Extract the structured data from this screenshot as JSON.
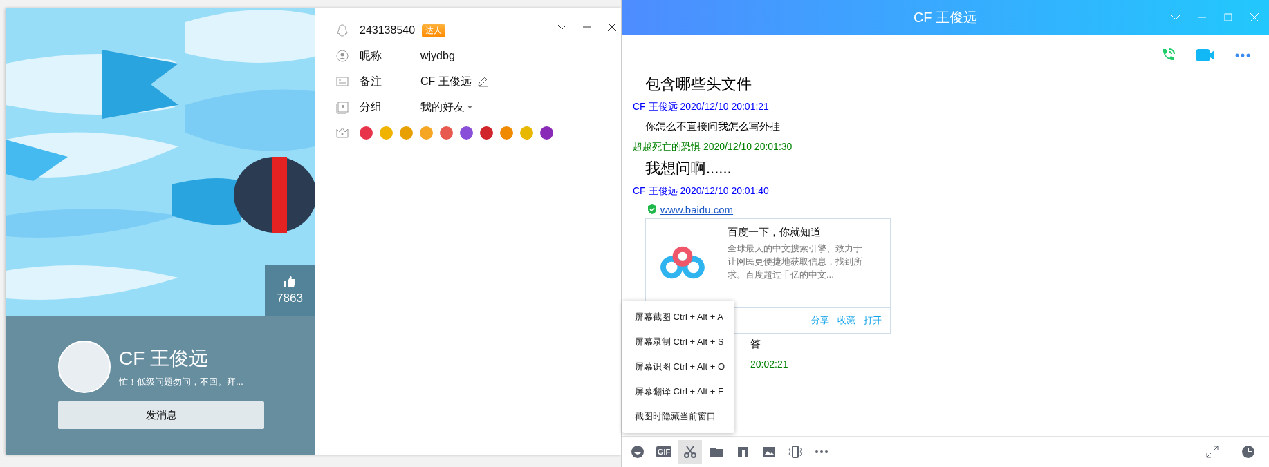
{
  "profile_window": {
    "qq_number": "243138540",
    "badge": "达人",
    "likes": "7863",
    "name": "CF 王俊远",
    "signature": "忙！低级问题勿问，不回。拜...",
    "send_button": "发消息",
    "fields": [
      {
        "kind": "nickname",
        "label": "昵称",
        "value": "wjydbg"
      },
      {
        "kind": "remark",
        "label": "备注",
        "value": "CF 王俊远"
      },
      {
        "kind": "group",
        "label": "分组",
        "value": "我的好友"
      }
    ],
    "medals": [
      {
        "color": "#e8344a"
      },
      {
        "color": "#f0b400"
      },
      {
        "color": "#e8a000"
      },
      {
        "color": "#f5a623"
      },
      {
        "color": "#e85a4f"
      },
      {
        "color": "#8a4fd8"
      },
      {
        "color": "#d0252a"
      },
      {
        "color": "#f08a00"
      },
      {
        "color": "#e8b800"
      },
      {
        "color": "#8a2bb8"
      }
    ]
  },
  "chat_window": {
    "title": "CF 王俊远",
    "messages": [
      {
        "kind": "big",
        "text": "包含哪些头文件"
      },
      {
        "kind": "meta",
        "text": "CF 王俊远 2020/12/10 20:01:21",
        "color": "#0000ff"
      },
      {
        "kind": "text",
        "text": "你怎么不直接问我怎么写外挂"
      },
      {
        "kind": "meta",
        "text": "超越死亡的恐惧 2020/12/10 20:01:30",
        "color": "#008000"
      },
      {
        "kind": "big",
        "text": "我想问啊......"
      },
      {
        "kind": "meta",
        "text": "CF 王俊远 2020/12/10 20:01:40",
        "color": "#0000ff"
      },
      {
        "kind": "link",
        "text": "www.baidu.com"
      }
    ],
    "card": {
      "title": "百度一下，你就知道",
      "description": "全球最大的中文搜索引擎、致力于让网民更便捷地获取信息，找到所求。百度超过千亿的中文...",
      "actions": [
        "分享",
        "收藏",
        "打开"
      ]
    },
    "after_card": [
      {
        "kind": "text",
        "text": "答"
      },
      {
        "kind": "meta",
        "text": "20:02:21",
        "color": "#008000"
      }
    ],
    "menu": [
      "屏幕截图 Ctrl + Alt + A",
      "屏幕录制 Ctrl + Alt + S",
      "屏幕识图 Ctrl + Alt + O",
      "屏幕翻译 Ctrl + Alt + F",
      "截图时隐藏当前窗口"
    ],
    "tools": [
      {
        "kind": "emoji",
        "selected": false
      },
      {
        "kind": "gif",
        "label": "GIF",
        "selected": false
      },
      {
        "kind": "scissors",
        "selected": true
      },
      {
        "kind": "folder",
        "selected": false
      },
      {
        "kind": "music",
        "selected": false
      },
      {
        "kind": "image",
        "selected": false
      },
      {
        "kind": "shake",
        "selected": false
      },
      {
        "kind": "more",
        "selected": false
      }
    ]
  }
}
